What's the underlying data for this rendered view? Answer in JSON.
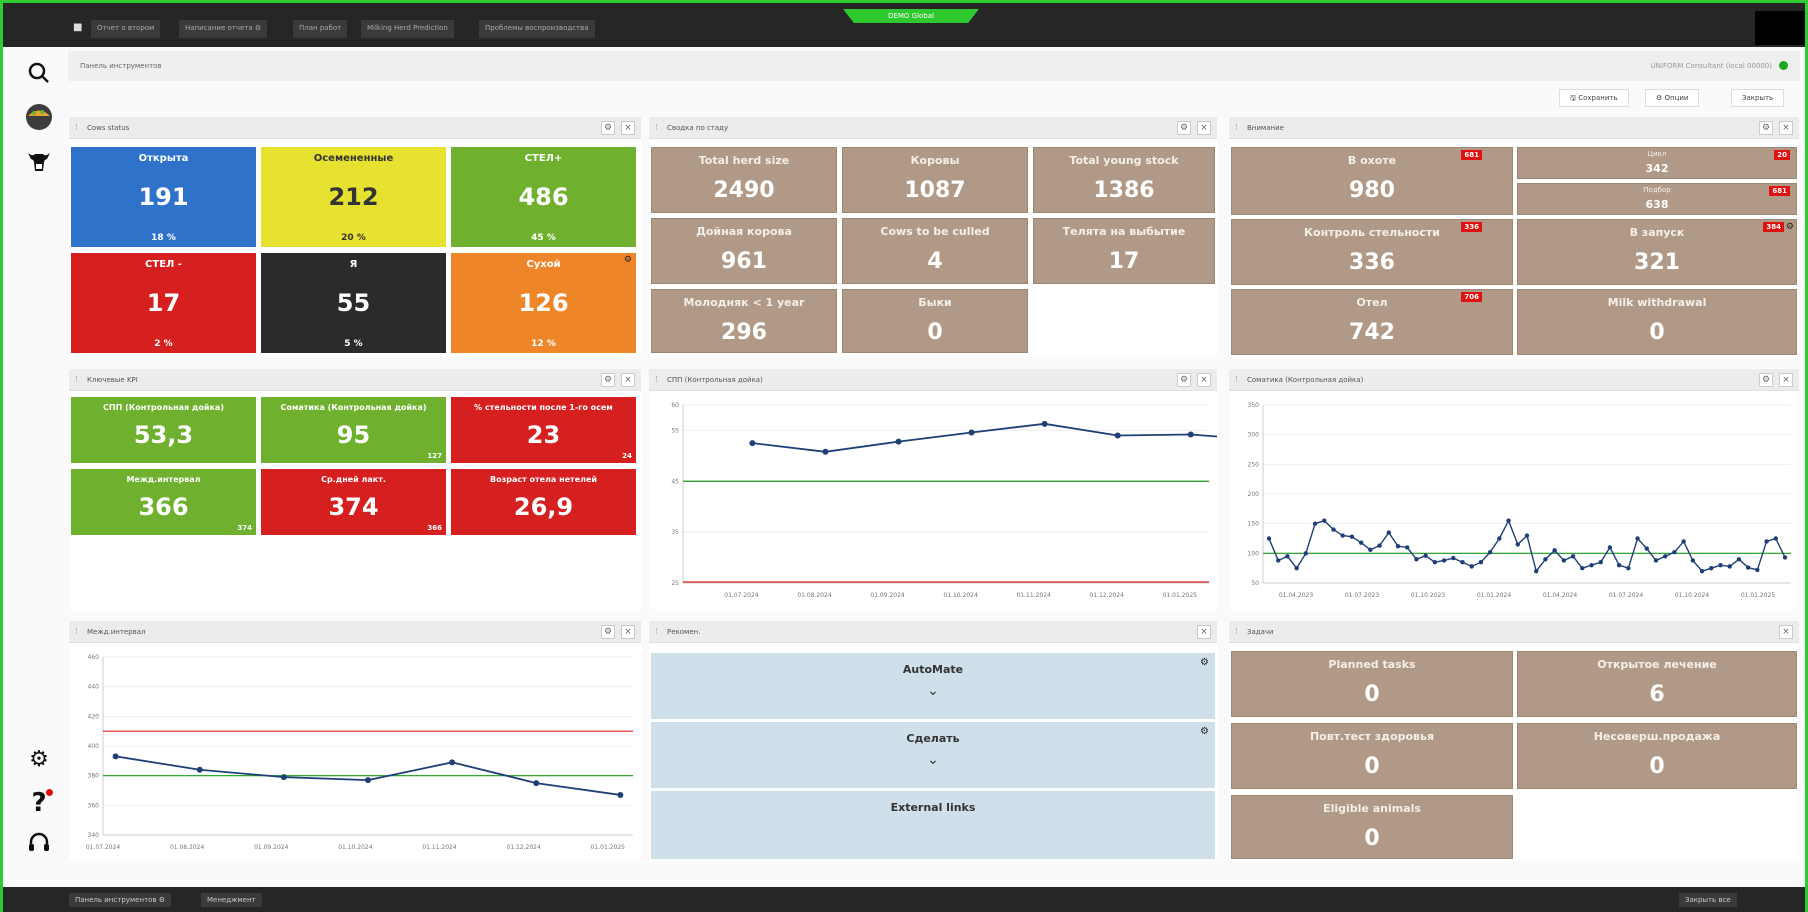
{
  "topbar": {
    "tabs": [
      "Отчет о втором",
      "Написание отчета ⚙",
      "План работ",
      "Milking Herd Prediction",
      "Проблемы воспроизводства"
    ],
    "env_label": "DEMO Global"
  },
  "header": {
    "title": "Панель инструментов",
    "user": "UNIFORM Consultant (local 00000)",
    "status_color": "#1ea61e"
  },
  "actions": {
    "save": "Сохранить",
    "options": "Опции",
    "close": "Закрыть"
  },
  "cows_status": {
    "title": "Cows status",
    "tiles": [
      {
        "title": "Открыта",
        "value": "191",
        "pct": "18 %"
      },
      {
        "title": "Осемененные",
        "value": "212",
        "pct": "20 %"
      },
      {
        "title": "СТЕЛ+",
        "value": "486",
        "pct": "45 %"
      },
      {
        "title": "СТЕЛ -",
        "value": "17",
        "pct": "2 %"
      },
      {
        "title": "Я",
        "value": "55",
        "pct": "5 %"
      },
      {
        "title": "Сухой",
        "value": "126",
        "pct": "12 %"
      }
    ]
  },
  "herd_summary": {
    "title": "Сводка по стаду",
    "tiles": [
      {
        "title": "Total herd size",
        "value": "2490"
      },
      {
        "title": "Коровы",
        "value": "1087"
      },
      {
        "title": "Total young stock",
        "value": "1386"
      },
      {
        "title": "Дойная корова",
        "value": "961"
      },
      {
        "title": "Cows to be culled",
        "value": "4"
      },
      {
        "title": "Телята на выбытие",
        "value": "17"
      },
      {
        "title": "Молодняк < 1 year",
        "value": "296"
      },
      {
        "title": "Быки",
        "value": "0"
      }
    ]
  },
  "attention": {
    "title": "Внимание",
    "tiles": [
      {
        "title": "В охоте",
        "value": "980",
        "badge": "681"
      },
      {
        "title": "Контроль стельности",
        "value": "336",
        "badge": "336"
      },
      {
        "title": "В запуск",
        "value": "321",
        "badge": "384"
      },
      {
        "title": "Отел",
        "value": "742",
        "badge": "706"
      },
      {
        "title": "Milk withdrawal",
        "value": "0",
        "badge": ""
      }
    ],
    "small": [
      {
        "title": "Цикл",
        "value": "342",
        "badge": "20"
      },
      {
        "title": "Подбор",
        "value": "638",
        "badge": "681"
      }
    ]
  },
  "kpi": {
    "title": "Ключевые KPI",
    "tiles": [
      {
        "title": "СПП (Контрольная дойка)",
        "value": "53,3",
        "extra": ""
      },
      {
        "title": "Соматика (Контрольная дойка)",
        "value": "95",
        "extra": "127"
      },
      {
        "title": "% стельности после 1-го осем",
        "value": "23",
        "extra": "24"
      },
      {
        "title": "Межд.интервал",
        "value": "366",
        "extra": "374"
      },
      {
        "title": "Ср.дней лакт.",
        "value": "374",
        "extra": "366"
      },
      {
        "title": "Возраст отела нетелей",
        "value": "26,9",
        "extra": ""
      }
    ]
  },
  "chart_spp": {
    "title": "СПП (Контрольная дойка)",
    "chart_data": {
      "type": "line",
      "categories": [
        "01.07.2024",
        "01.08.2024",
        "01.09.2024",
        "01.10.2024",
        "01.11.2024",
        "01.12.2024",
        "01.01.2025"
      ],
      "x": [
        0.15,
        1.15,
        2.15,
        3.15,
        4.15,
        5.15,
        6.15,
        7.15
      ],
      "values": [
        52.5,
        50.8,
        52.8,
        54.6,
        56.3,
        54.0,
        54.2,
        53.1
      ],
      "target": 45,
      "lower": 25,
      "ylim": [
        25,
        60
      ],
      "yticks": [
        25,
        35,
        45,
        55,
        60
      ]
    }
  },
  "chart_som": {
    "title": "Соматика (Контрольная дойка)",
    "chart_data": {
      "type": "line",
      "categories": [
        "01.04.2023",
        "01.07.2023",
        "01.10.2023",
        "01.01.2024",
        "01.04.2024",
        "01.07.2024",
        "01.10.2024",
        "01.01.2025"
      ],
      "values": [
        125,
        88,
        95,
        75,
        100,
        150,
        155,
        140,
        130,
        128,
        118,
        106,
        113,
        135,
        112,
        110,
        90,
        96,
        85,
        88,
        92,
        85,
        78,
        85,
        102,
        125,
        155,
        115,
        130,
        70,
        90,
        105,
        88,
        95,
        75,
        80,
        85,
        110,
        80,
        75,
        125,
        108,
        88,
        95,
        102,
        120,
        88,
        70,
        75,
        80,
        78,
        90,
        76,
        72,
        120,
        125,
        93
      ],
      "target": 100,
      "ylim": [
        50,
        350
      ],
      "yticks": [
        50,
        100,
        150,
        200,
        250,
        300,
        350
      ]
    }
  },
  "chart_int": {
    "title": "Межд.интервал",
    "chart_data": {
      "type": "line",
      "categories": [
        "01.07.2024",
        "01.08.2024",
        "01.09.2024",
        "01.10.2024",
        "01.11.2024",
        "01.12.2024",
        "01.01.2025"
      ],
      "x": [
        0.15,
        1.15,
        2.15,
        3.15,
        4.15,
        5.15,
        6.15
      ],
      "values": [
        393,
        384,
        379,
        377,
        389,
        375,
        367
      ],
      "target_high": 410,
      "target_low": 380,
      "ylim": [
        340,
        460
      ],
      "yticks": [
        340,
        360,
        380,
        400,
        420,
        440,
        460
      ]
    }
  },
  "recommend": {
    "title": "Рекомен.",
    "items": [
      {
        "title": "AutoMate",
        "chevron": "⌄"
      },
      {
        "title": "Сделать",
        "chevron": "⌄"
      },
      {
        "title": "External links",
        "chevron": ""
      }
    ]
  },
  "tasks": {
    "title": "Задачи",
    "tiles": [
      {
        "title": "Planned tasks",
        "value": "0"
      },
      {
        "title": "Открытое лечение",
        "value": "6"
      },
      {
        "title": "Повт.тест здоровья",
        "value": "0"
      },
      {
        "title": "Несоверш.продажа",
        "value": "0"
      },
      {
        "title": "Eligible animals",
        "value": "0"
      }
    ]
  },
  "footer": {
    "tab1": "Панель инструментов ⚙",
    "tab2": "Менеджмент",
    "close_all": "Закрыть все"
  }
}
